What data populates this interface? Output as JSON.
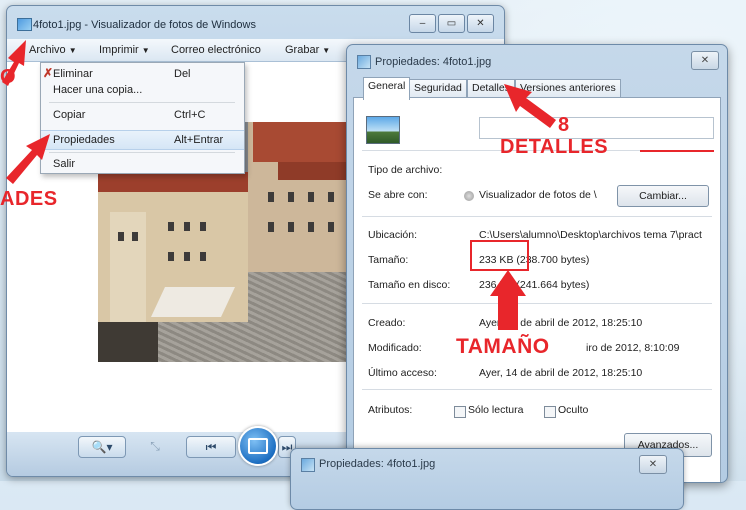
{
  "viewer": {
    "title": "4foto1.jpg - Visualizador de fotos de Windows",
    "window_buttons": [
      "–",
      "▭",
      "✕"
    ],
    "menu": [
      {
        "label": "Archivo",
        "has_arrow": true
      },
      {
        "label": "Imprimir",
        "has_arrow": true
      },
      {
        "label": "Correo electrónico",
        "has_arrow": false
      },
      {
        "label": "Grabar",
        "has_arrow": true
      }
    ],
    "dropdown": [
      {
        "label": "Eliminar",
        "shortcut": "Del",
        "icon": "delete-x-icon"
      },
      {
        "label": "Hacer una copia...",
        "shortcut": ""
      },
      {
        "label": "Copiar",
        "shortcut": "Ctrl+C"
      },
      {
        "label": "Propiedades",
        "shortcut": "Alt+Entrar",
        "highlighted": true
      },
      {
        "label": "Salir",
        "shortcut": ""
      }
    ],
    "toolbar": {
      "zoom": "🔍▾",
      "fit": "⤡",
      "prev": "⏮",
      "next": "⏭"
    }
  },
  "dialog": {
    "title": "Propiedades: 4foto1.jpg",
    "close": "✕",
    "tabs": [
      "General",
      "Seguridad",
      "Detalles",
      "Versiones anteriores"
    ],
    "active_tab": "General",
    "properties": {
      "tipo_label": "Tipo de archivo:",
      "tipo_value": "",
      "abre_label": "Se abre con:",
      "abre_value": "Visualizador de fotos de \\",
      "cambiar_button": "Cambiar...",
      "ubicacion_label": "Ubicación:",
      "ubicacion_value": "C:\\Users\\alumno\\Desktop\\archivos tema 7\\pract",
      "tamano_label": "Tamaño:",
      "tamano_value": "233 KB (238.700 bytes)",
      "tamano_disco_label": "Tamaño en disco:",
      "tamano_disco_value": "236 KB (241.664 bytes)",
      "creado_label": "Creado:",
      "creado_value": "Ayer, 14 de abril de 2012, 18:25:10",
      "modificado_label": "Modificado:",
      "modificado_value": "iro de 2012, 8:10:09",
      "acceso_label": "Último acceso:",
      "acceso_value": "Ayer, 14 de abril de 2012, 18:25:10",
      "atributos_label": "Atributos:",
      "solo_lectura": "Sólo lectura",
      "oculto": "Oculto",
      "avanzados_button": "Avanzados..."
    }
  },
  "dialog2": {
    "title": "Propiedades: 4foto1.jpg",
    "close": "✕"
  },
  "annotations": {
    "left_top": "O",
    "left_bottom": "ADES",
    "detalles_number": "8",
    "detalles_label": "DETALLES",
    "tamano_label": "TAMAÑO",
    "color": "#e8262b"
  }
}
